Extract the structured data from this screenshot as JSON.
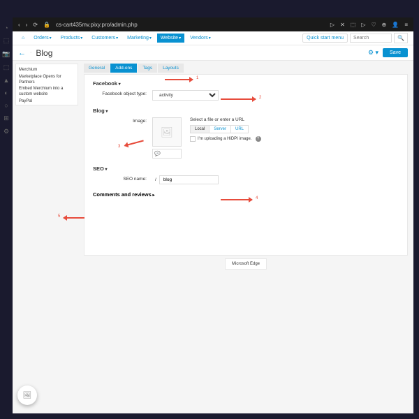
{
  "browser": {
    "url": "cs-cart435mv.pixy.pro/admin.php"
  },
  "nav": {
    "items": [
      "Orders",
      "Products",
      "Customers",
      "Marketing",
      "Website",
      "Vendors"
    ],
    "active_idx": 4,
    "quick_start": "Quick start menu",
    "search_ph": "Search"
  },
  "page": {
    "back": "←",
    "title": "Blog",
    "save": "Save"
  },
  "sidebar": {
    "items": [
      "Merchium",
      "Marketplace Opens for Partners",
      "Embed Merchium into a custom website",
      "PayPal"
    ]
  },
  "tabs": {
    "items": [
      "General",
      "Add-ons",
      "Tags",
      "Layouts"
    ],
    "active_idx": 1
  },
  "sections": {
    "facebook": {
      "title": "Facebook",
      "object_type_label": "Facebook object type:",
      "object_type_value": "activity"
    },
    "blog": {
      "title": "Blog",
      "image_label": "Image:",
      "select_text": "Select a file or enter a URL",
      "toggle": [
        "Local",
        "Server",
        "URL"
      ],
      "hidpi_label": "I'm uploading a HiDPI image."
    },
    "seo": {
      "title": "SEO",
      "name_label": "SEO name:",
      "prefix": "/",
      "value": "blog"
    },
    "comments": {
      "title": "Comments and reviews"
    }
  },
  "annotations": {
    "a1": "1",
    "a2": "2",
    "a3": "3",
    "a4": "4",
    "a5": "5"
  },
  "footer": {
    "text": "Microsoft Edge"
  }
}
